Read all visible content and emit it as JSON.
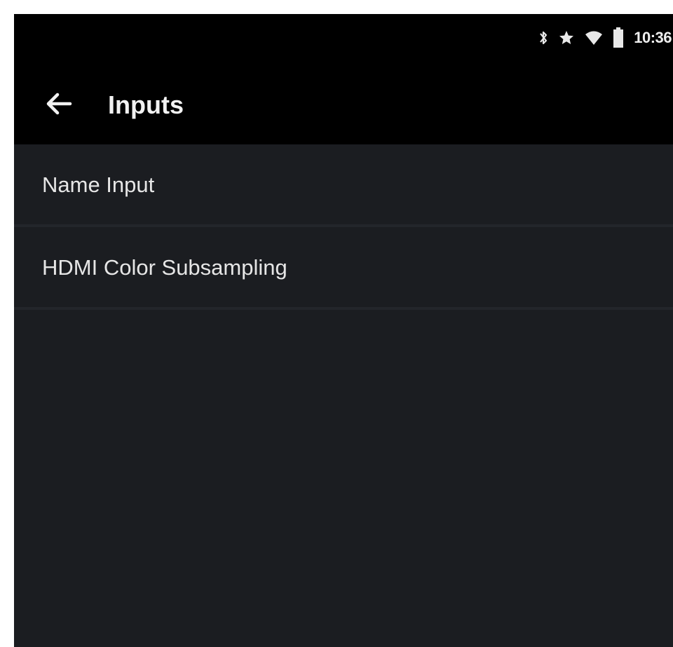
{
  "status_bar": {
    "icons": [
      "bluetooth-icon",
      "star-icon",
      "wifi-icon",
      "battery-icon"
    ],
    "time": "10:36"
  },
  "app_bar": {
    "back_icon": "arrow-left-icon",
    "title": "Inputs"
  },
  "settings_list": {
    "items": [
      {
        "label": "Name Input"
      },
      {
        "label": "HDMI Color Subsampling"
      }
    ]
  },
  "colors": {
    "background": "#1b1d21",
    "bars": "#000000",
    "text": "#e6e6e6"
  }
}
